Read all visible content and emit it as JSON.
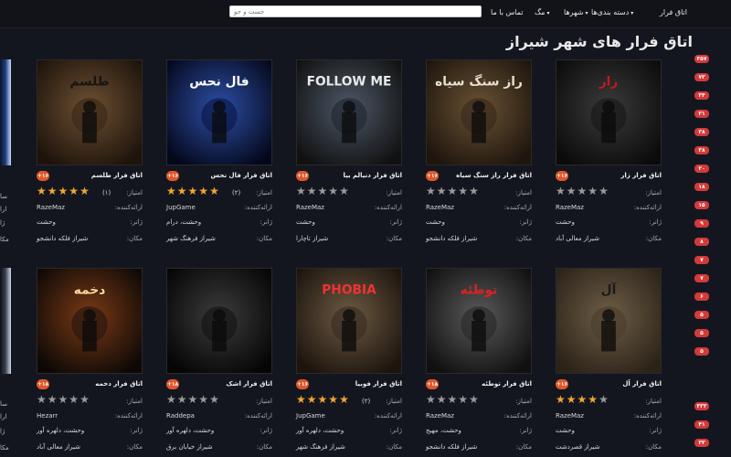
{
  "nav": {
    "items": [
      {
        "label": "اتاق فرار",
        "dropdown": false
      },
      {
        "label": "دسته بندی‌ها",
        "dropdown": true
      },
      {
        "label": "شهرها",
        "dropdown": true
      },
      {
        "label": "مگ",
        "dropdown": true
      },
      {
        "label": "تماس با ما",
        "dropdown": false
      }
    ],
    "search_placeholder": "جست و جو"
  },
  "page_title": "اتاق فرار های شهر شیراز",
  "labels": {
    "rating": "امتیاز:",
    "maker": "ارائه‌کننده:",
    "genre": "ژانر:",
    "location": "مکان:"
  },
  "sidebar_counts": [
    "۳۵۷",
    "۷۳",
    "۳۴",
    "۳۱",
    "۳۸",
    "۳۸",
    "۲۰",
    "۱۸",
    "۱۵",
    "۹",
    "۸",
    "۷",
    "۷",
    "۶",
    "۵",
    "۵",
    "۵",
    "۳۳۳",
    "۴۱",
    "۳۳"
  ],
  "cards": [
    {
      "name": "اتاق فرار زار",
      "badge": "+۱۶",
      "stars": 0,
      "votes": "",
      "maker": "RazeMaz",
      "genre": "وحشت",
      "location": "شیراز معالی آباد"
    },
    {
      "name": "اتاق فرار راز سنگ سیاه",
      "badge": "+۱۶",
      "stars": 0,
      "votes": "",
      "maker": "RazeMaz",
      "genre": "وحشت",
      "location": "شیراز فلکه دانشجو"
    },
    {
      "name": "اتاق فرار دنیالم بیا",
      "badge": "+۱۶",
      "stars": 0,
      "votes": "",
      "maker": "RazeMaz",
      "genre": "وحشت",
      "location": "شیراز تاچارا"
    },
    {
      "name": "اتاق فرار فال نحس",
      "badge": "+۱۶",
      "stars": 5,
      "votes": "(۲)",
      "maker": "JupGame",
      "genre": "وحشت، درام",
      "location": "شیراز فرهنگ شهر"
    },
    {
      "name": "اتاق فرار طلسم",
      "badge": "+۱۶",
      "stars": 5,
      "votes": "(۱)",
      "maker": "RazeMaz",
      "genre": "وحشت",
      "location": "شیراز فلکه دانشجو"
    },
    {
      "name": "اتاق فرار آل",
      "badge": "+۱۶",
      "stars": 4,
      "votes": "",
      "maker": "RazeMaz",
      "genre": "وحشت",
      "location": "شیراز قصردشت"
    },
    {
      "name": "اتاق فرار توطئه",
      "badge": "+۱۸",
      "stars": 0,
      "votes": "",
      "maker": "RazeMaz",
      "genre": "وحشت، مهیج",
      "location": "شیراز فلکه دانشجو"
    },
    {
      "name": "اتاق فرار فوبیا",
      "badge": "+۱۶",
      "stars": 5,
      "votes": "(۲)",
      "maker": "JupGame",
      "genre": "وحشت، دلهره آور",
      "location": "شیراز فرهنگ شهر"
    },
    {
      "name": "اتاق فرار اشک",
      "badge": "+۱۸",
      "stars": 0,
      "votes": "",
      "maker": "Raddepa",
      "genre": "وحشت، دلهره آور",
      "location": "شیراز خیابان برق"
    },
    {
      "name": "اتاق فرار دخمه",
      "badge": "+۱۸",
      "stars": 0,
      "votes": "",
      "maker": "Hezarr",
      "genre": "وحشت، دلهره آور",
      "location": "شیراز معالی آباد"
    }
  ],
  "cover_texts": [
    "زار",
    "راز سنگ سیاه",
    "FOLLOW ME",
    "فال نحس",
    "طلسم",
    "آل",
    "توطئه",
    "PHOBIA",
    "",
    "دخمه"
  ],
  "partial_left": {
    "labels": [
      "سا",
      "ارا",
      "ژا",
      "مکا"
    ]
  }
}
